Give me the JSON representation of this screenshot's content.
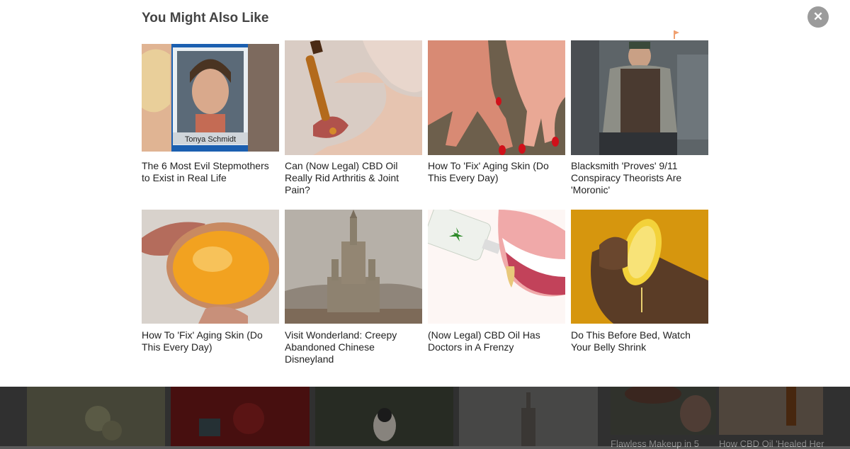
{
  "modal": {
    "title": "You Might Also Like",
    "close_icon": "close-icon",
    "ad_icon": "ad-choices-flag-icon",
    "cards": [
      {
        "caption": "The 6 Most Evil Stepmothers to Exist in Real Life",
        "image_label": "Tonya Schmidt"
      },
      {
        "caption": "Can (Now Legal) CBD Oil Really Rid Arthritis & Joint Pain?"
      },
      {
        "caption": "How To 'Fix' Aging Skin (Do This Every Day)"
      },
      {
        "caption": "Blacksmith 'Proves' 9/11 Conspiracy Theorists Are 'Moronic'"
      },
      {
        "caption": "How To 'Fix' Aging Skin (Do This Every Day)"
      },
      {
        "caption": "Visit Wonderland: Creepy Abandoned Chinese Disneyland"
      },
      {
        "caption": "(Now Legal) CBD Oil Has Doctors in A Frenzy"
      },
      {
        "caption": "Do This Before Bed, Watch Your Belly Shrink"
      }
    ]
  },
  "background": {
    "captions": [
      "Flawless Makeup in 5",
      "How CBD Oil 'Healed Her"
    ]
  },
  "colors": {
    "modal_bg": "#ffffff",
    "title": "#444444",
    "close_btn": "#9b9b9b",
    "backdrop": "#4b4b4b"
  }
}
